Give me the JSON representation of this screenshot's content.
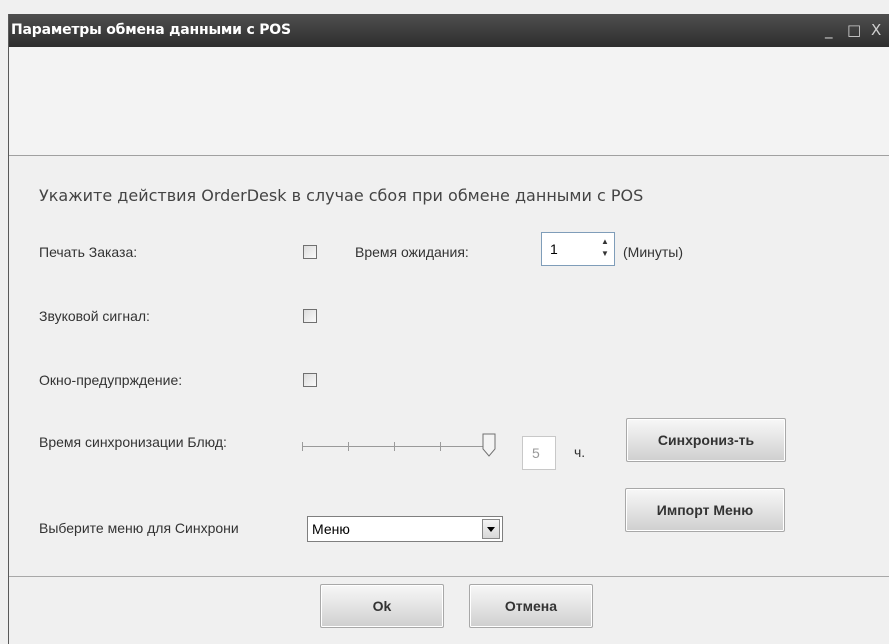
{
  "window": {
    "title": "Параметры обмена данными с POS",
    "minimize": "_",
    "maximize": "□",
    "close": "X"
  },
  "prompt": "Укажите действия OrderDesk в случае сбоя при обмене данными с POS",
  "print_order": {
    "label": "Печать Заказа:",
    "checked": false
  },
  "wait_time": {
    "label": "Время ожидания:",
    "value": "1",
    "unit": "(Минуты)"
  },
  "sound_signal": {
    "label": "Звуковой сигнал:",
    "checked": false
  },
  "warning_window": {
    "label": "Окно-предупрждение:",
    "checked": false
  },
  "sync_time": {
    "label": "Время синхронизации Блюд:",
    "value": "5",
    "unit": "ч."
  },
  "sync_button": "Синхрониз-ть",
  "menu_select": {
    "label": "Выберите меню для Синхрони",
    "value": "Меню"
  },
  "import_button": "Импорт Меню",
  "footer": {
    "ok": "Ok",
    "cancel": "Отмена"
  }
}
